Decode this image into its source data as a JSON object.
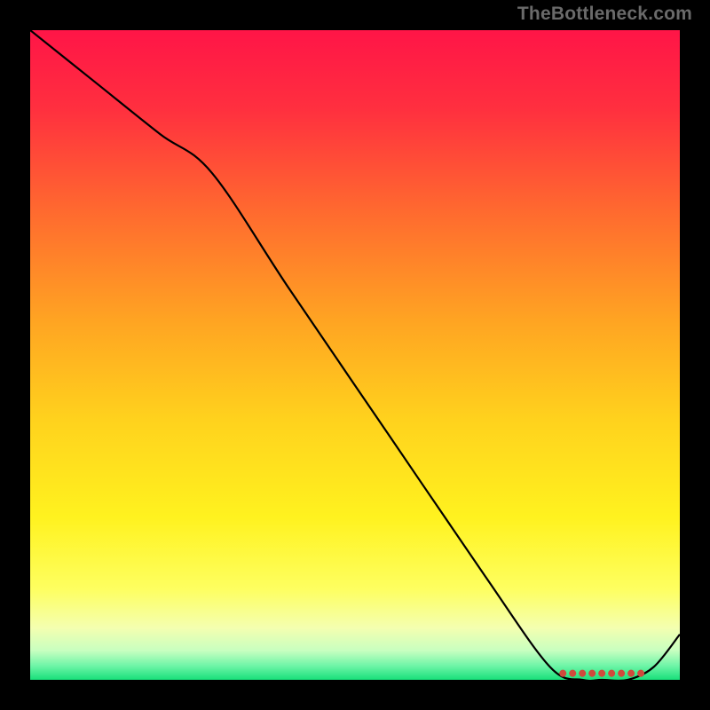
{
  "attribution": "TheBottleneck.com",
  "chart_data": {
    "type": "line",
    "title": "",
    "xlabel": "",
    "ylabel": "",
    "xlim": [
      0,
      100
    ],
    "ylim": [
      0,
      100
    ],
    "x": [
      0,
      10,
      20,
      28,
      40,
      55,
      70,
      80,
      85,
      88,
      92,
      96,
      100
    ],
    "values": [
      100,
      92,
      84,
      78,
      60,
      38,
      16,
      2,
      0,
      0,
      0,
      2,
      7
    ],
    "annotations": [
      {
        "type": "dotted-segment",
        "x0": 82,
        "y0": 1,
        "x1": 94,
        "y1": 1,
        "color": "#d04a3c"
      }
    ],
    "background_gradient_stops": [
      {
        "offset": 0.0,
        "color": "#ff1547"
      },
      {
        "offset": 0.12,
        "color": "#ff2f3f"
      },
      {
        "offset": 0.28,
        "color": "#ff6a2f"
      },
      {
        "offset": 0.45,
        "color": "#ffa522"
      },
      {
        "offset": 0.6,
        "color": "#ffd21d"
      },
      {
        "offset": 0.75,
        "color": "#fff21f"
      },
      {
        "offset": 0.86,
        "color": "#feff60"
      },
      {
        "offset": 0.92,
        "color": "#f4ffb0"
      },
      {
        "offset": 0.955,
        "color": "#c8ffc0"
      },
      {
        "offset": 0.978,
        "color": "#70f5a8"
      },
      {
        "offset": 1.0,
        "color": "#18e07a"
      }
    ]
  }
}
